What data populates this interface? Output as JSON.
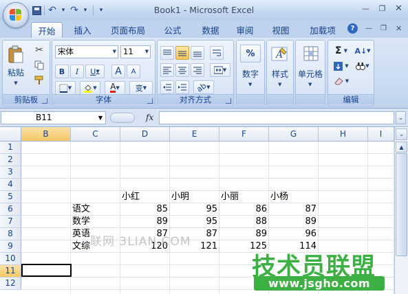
{
  "window": {
    "title": "Book1 - Microsoft Excel"
  },
  "qat": {
    "undo": "↶",
    "redo": "↷",
    "dropdown": "▾"
  },
  "tabs": [
    {
      "label": "开始",
      "active": true
    },
    {
      "label": "插入"
    },
    {
      "label": "页面布局"
    },
    {
      "label": "公式"
    },
    {
      "label": "数据"
    },
    {
      "label": "审阅"
    },
    {
      "label": "视图"
    },
    {
      "label": "加载项"
    }
  ],
  "ribbon": {
    "clipboard": {
      "label": "剪贴板",
      "paste_label": "粘贴"
    },
    "font": {
      "label": "字体",
      "font_name": "宋体",
      "font_size": "11",
      "bold": "B",
      "italic": "I",
      "underline": "U",
      "grow": "A",
      "shrink": "A",
      "color_a": "A",
      "wen": "变"
    },
    "alignment": {
      "label": "对齐方式"
    },
    "number": {
      "label": "数字",
      "pct": "%"
    },
    "styles": {
      "label": "样式"
    },
    "cells": {
      "label": "单元格"
    },
    "editing": {
      "label": "编辑",
      "sigma": "Σ"
    }
  },
  "formula_bar": {
    "name_box": "B11",
    "fx": "fx",
    "value": ""
  },
  "columns": [
    "B",
    "C",
    "D",
    "E",
    "F",
    "G",
    "H",
    "I"
  ],
  "rows": [
    "1",
    "2",
    "3",
    "4",
    "5",
    "6",
    "7",
    "8",
    "9",
    "10",
    "11",
    "12"
  ],
  "table": {
    "header": [
      "小红",
      "小明",
      "小丽",
      "小杨"
    ],
    "rows": [
      {
        "subject": "语文",
        "values": [
          "85",
          "95",
          "86",
          "87"
        ]
      },
      {
        "subject": "数学",
        "values": [
          "89",
          "95",
          "88",
          "89"
        ]
      },
      {
        "subject": "英语",
        "values": [
          "87",
          "87",
          "89",
          "96"
        ]
      },
      {
        "subject": "文综",
        "values": [
          "120",
          "121",
          "125",
          "114"
        ]
      }
    ]
  },
  "watermarks": {
    "text": "联网 3LIAN.COM",
    "logo": "技术员联盟",
    "url": "www.jsgho.com"
  },
  "colors": {
    "selected_header": "#f6c766",
    "logo_green": "#3cb043"
  }
}
